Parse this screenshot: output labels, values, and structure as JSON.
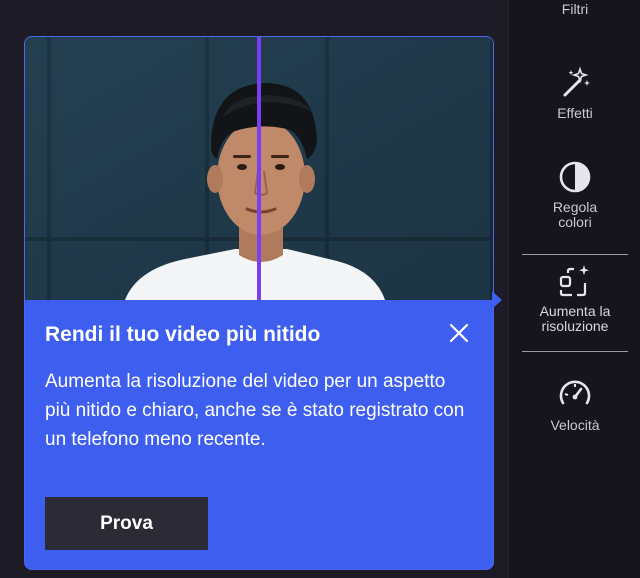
{
  "sidebar": {
    "items": [
      {
        "label": "Filtri",
        "icon": "filter-icon"
      },
      {
        "label": "Effetti",
        "icon": "magic-wand-icon"
      },
      {
        "label": "Regola colori",
        "icon": "contrast-icon"
      },
      {
        "label": "Aumenta la risoluzione",
        "icon": "upscale-icon",
        "active": true
      },
      {
        "label": "Velocità",
        "icon": "speedometer-icon"
      }
    ]
  },
  "popup": {
    "title": "Rendi il tuo video più nitido",
    "body": "Aumenta la risoluzione del video per un aspetto più nitido e chiaro, anche se è stato registrato con un telefono meno recente.",
    "button_label": "Prova",
    "preview_icon": "before-after-comparison-image"
  },
  "colors": {
    "popup_bg": "#3e5ef0",
    "split_line": "#7b3ff2",
    "button_bg": "#2b2a35",
    "sidebar_bg": "#16151d"
  }
}
